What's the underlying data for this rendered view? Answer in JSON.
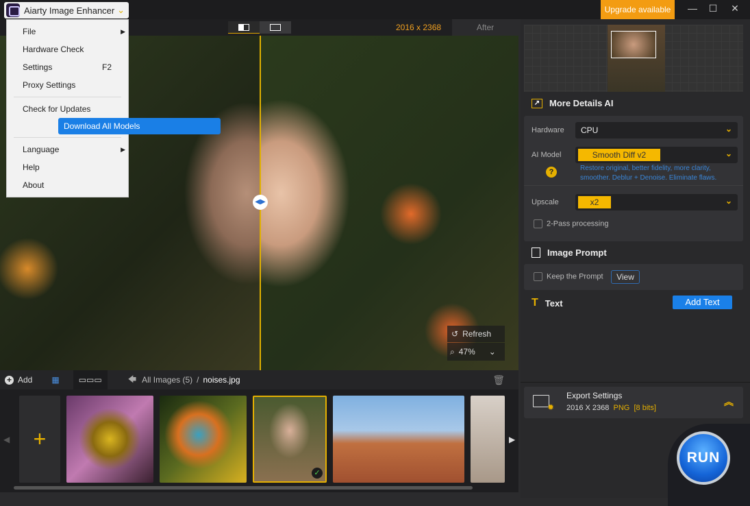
{
  "app": {
    "title": "Aiarty Image Enhancer",
    "upgrade": "Upgrade available"
  },
  "menu": {
    "items": [
      {
        "label": "File",
        "submenu": true
      },
      {
        "label": "Hardware Check"
      },
      {
        "label": "Settings",
        "shortcut": "F2"
      },
      {
        "label": "Proxy Settings"
      },
      {
        "label": "Check for Updates"
      },
      {
        "label": "Download All Models",
        "selected": true
      },
      {
        "label": "Language",
        "submenu": true
      },
      {
        "label": "Help"
      },
      {
        "label": "About"
      }
    ]
  },
  "viewer": {
    "dimensions": "2016 x 2368",
    "after_label": "After",
    "refresh": "Refresh",
    "zoom": "47%"
  },
  "bottombar": {
    "add": "Add",
    "breadcrumb_root": "All Images (5)",
    "separator": "/",
    "current_file": "noises.jpg"
  },
  "panel": {
    "section_title": "More Details AI",
    "hardware_label": "Hardware",
    "hardware_value": "CPU",
    "model_label": "AI Model",
    "model_value": "Smooth Diff v2",
    "model_desc": "Restore original, better fidelity, more clarity, smoother. Deblur + Denoise. Eliminate flaws.",
    "upscale_label": "Upscale",
    "upscale_value": "x2",
    "two_pass": "2-Pass processing",
    "prompt_title": "Image Prompt",
    "keep_prompt": "Keep the Prompt",
    "view": "View",
    "text_title": "Text",
    "add_text": "Add Text",
    "export_title": "Export Settings",
    "export_dims": "2016 X 2368",
    "export_format": "PNG",
    "export_bits": "[8 bits]",
    "run": "RUN"
  },
  "colors": {
    "accent": "#f5b800",
    "blue": "#1a80e8",
    "upgrade": "#f39c12"
  }
}
